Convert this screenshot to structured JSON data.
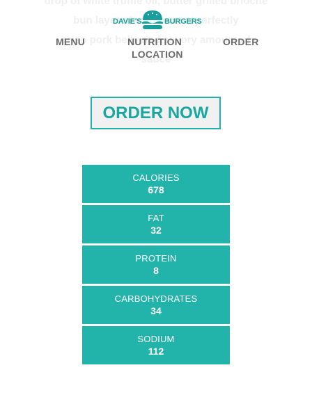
{
  "background_text": {
    "line1": "drop of white truffle oil, butter grilled brioche",
    "line2": "bun layered with bacon, perfectly",
    "line3": "crisp pork belly and savory amount of",
    "line4": "sauce"
  },
  "header": {
    "logo": {
      "left_word": "DAVIE'S",
      "right_word": "BURGERS",
      "icon": "burger-icon"
    },
    "nav": {
      "menu": "MENU",
      "nutrition": "NUTRITION",
      "order": "ORDER",
      "location": "LOCATION"
    }
  },
  "cta": {
    "order_now": "ORDER NOW"
  },
  "nutrition": {
    "items": [
      {
        "label": "CALORIES",
        "value": "678"
      },
      {
        "label": "FAT",
        "value": "32"
      },
      {
        "label": "PROTEIN",
        "value": "8"
      },
      {
        "label": "CARBOHYDRATES",
        "value": "34"
      },
      {
        "label": "SODIUM",
        "value": "112"
      }
    ]
  },
  "colors": {
    "accent": "#22b3ab",
    "brand": "#1a9e9b",
    "nav_text": "#6b6b6b",
    "button_bg": "#f1f1f1"
  }
}
